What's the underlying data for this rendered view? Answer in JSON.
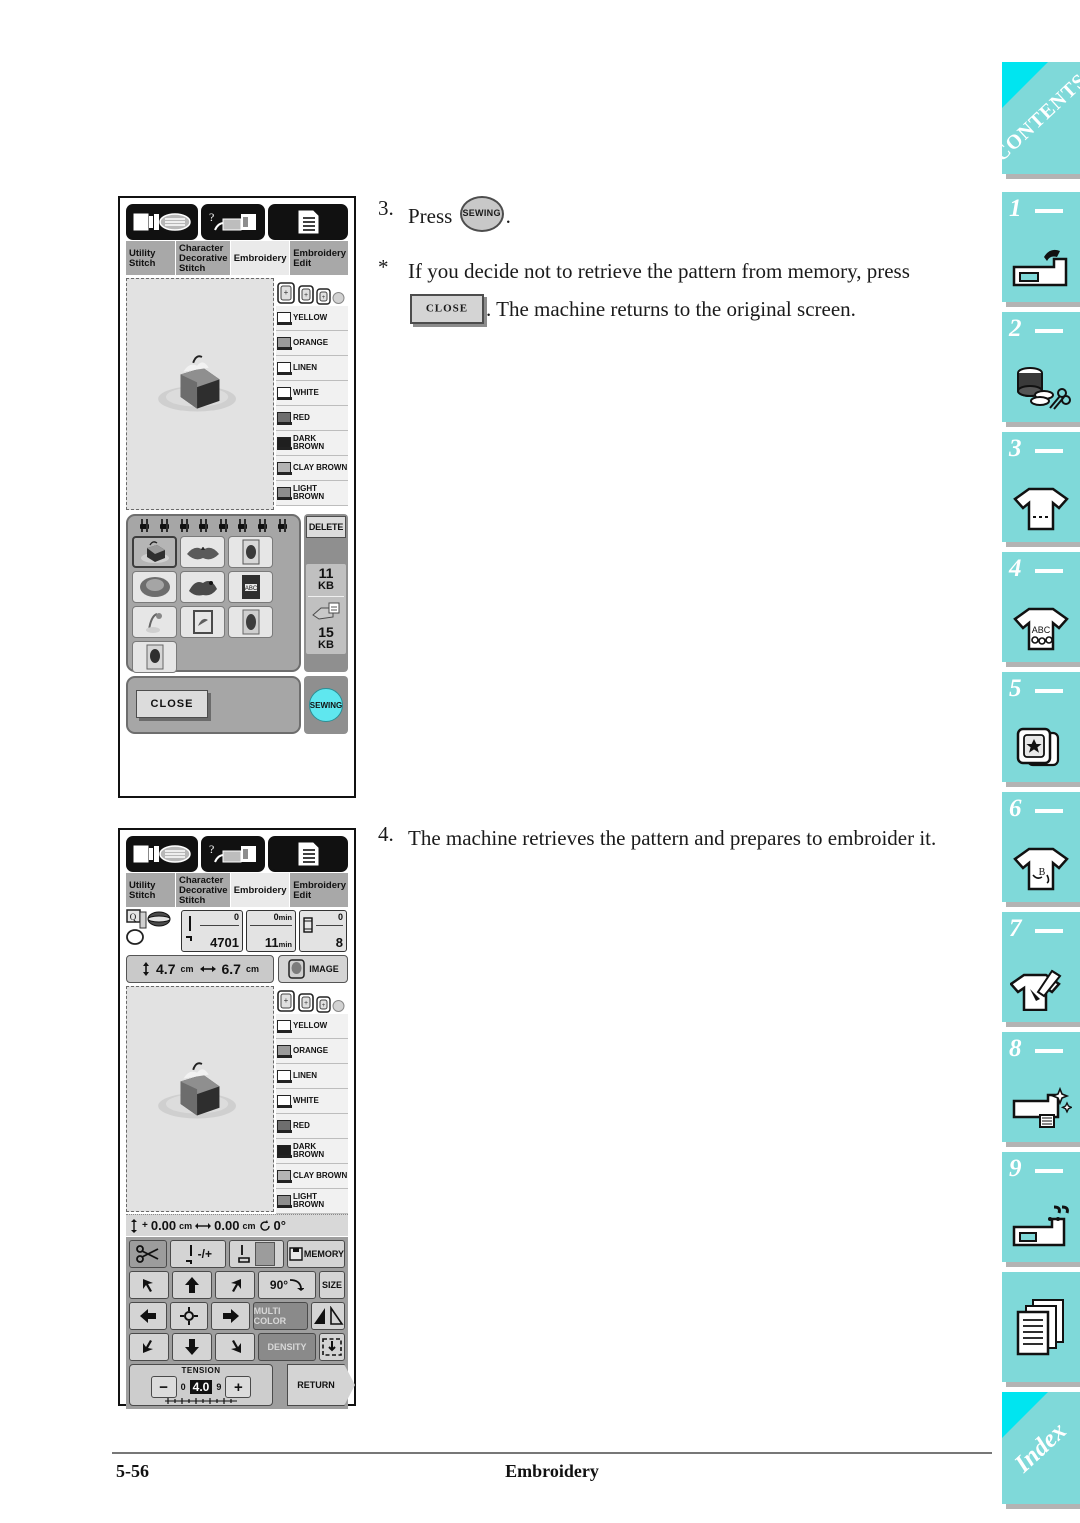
{
  "page": {
    "footer_page_number": "5-56",
    "footer_title": "Embroidery"
  },
  "steps": [
    {
      "number": "3.",
      "text_before": "Press",
      "key_label": "SEWING",
      "text_after": "."
    },
    {
      "number": "*",
      "text_before": "If you decide not to retrieve the pattern from memory, press",
      "key_label": "CLOSE",
      "text_after": ". The machine returns to the original screen."
    },
    {
      "number": "4.",
      "text": "The machine retrieves the pattern and prepares to embroider it."
    }
  ],
  "lcd_tabs": [
    {
      "label": "Utility Stitch",
      "active": false
    },
    {
      "label": "Character Decorative Stitch",
      "active": false
    },
    {
      "label": "Embroidery",
      "active": true
    },
    {
      "label": "Embroidery Edit",
      "active": false
    }
  ],
  "thread_colors": [
    {
      "name": "YELLOW",
      "fill": "#ffffff"
    },
    {
      "name": "ORANGE",
      "fill": "#9a9a9a"
    },
    {
      "name": "LINEN",
      "fill": "#ffffff"
    },
    {
      "name": "WHITE",
      "fill": "#ffffff"
    },
    {
      "name": "RED",
      "fill": "#6e6e6e"
    },
    {
      "name": "DARK BROWN",
      "fill": "#1f1f1f"
    },
    {
      "name": "CLAY BROWN",
      "fill": "#b4b4b4"
    },
    {
      "name": "LIGHT BROWN",
      "fill": "#8d8d8d"
    }
  ],
  "screen1": {
    "delete_label": "DELETE",
    "machine_memory": {
      "value": "11",
      "unit": "KB"
    },
    "card_memory": {
      "value": "15",
      "unit": "KB"
    },
    "close_label": "CLOSE",
    "sewing_label": "SEWING",
    "pattern_count": 10
  },
  "screen2": {
    "stitch_current": "0",
    "stitch_total": "4701",
    "time_current": "0",
    "time_current_unit": "min",
    "time_total": "11",
    "time_total_unit": "min",
    "color_current": "0",
    "color_total": "8",
    "size_height": "4.7",
    "size_height_unit": "cm",
    "size_width": "6.7",
    "size_width_unit": "cm",
    "image_label": "IMAGE",
    "pos_vertical": "0.00",
    "pos_vertical_unit": "cm",
    "pos_horizontal": "0.00",
    "pos_horizontal_unit": "cm",
    "rotation": "0°",
    "controls": {
      "thread_cut": "",
      "needle_pos": "-/+",
      "memory": "MEMORY",
      "rotate": "90°",
      "size": "SIZE",
      "multi_color": "MULTI COLOR",
      "density": "DENSITY",
      "return": "RETURN"
    },
    "tension": {
      "label": "TENSION",
      "min": "0",
      "max": "9",
      "value": "4.0",
      "minus": "−",
      "plus": "+"
    }
  },
  "sidebar": {
    "accent_color": "#7fd9d9",
    "corner_color": "#00e5f0",
    "tabs": [
      {
        "id": "contents",
        "label": "CONTENTS",
        "number": "",
        "icon": "contents-corner"
      },
      {
        "id": "chapter-1",
        "label": "",
        "number": "1",
        "icon": "sewing-machine-icon"
      },
      {
        "id": "chapter-2",
        "label": "",
        "number": "2",
        "icon": "spool-scissors-icon"
      },
      {
        "id": "chapter-3",
        "label": "",
        "number": "3",
        "icon": "tshirt-stitch-icon"
      },
      {
        "id": "chapter-4",
        "label": "",
        "number": "4",
        "icon": "tshirt-abc-icon"
      },
      {
        "id": "chapter-5",
        "label": "",
        "number": "5",
        "icon": "hoop-star-icon"
      },
      {
        "id": "chapter-6",
        "label": "",
        "number": "6",
        "icon": "tshirt-letter-icon"
      },
      {
        "id": "chapter-7",
        "label": "",
        "number": "7",
        "icon": "tshirt-pen-icon"
      },
      {
        "id": "chapter-8",
        "label": "",
        "number": "8",
        "icon": "machine-sparkle-icon"
      },
      {
        "id": "chapter-9",
        "label": "",
        "number": "9",
        "icon": "machine-question-icon"
      },
      {
        "id": "appendix",
        "label": "",
        "number": "",
        "icon": "pages-icon"
      },
      {
        "id": "index",
        "label": "Index",
        "number": "",
        "icon": "index-corner"
      }
    ]
  }
}
